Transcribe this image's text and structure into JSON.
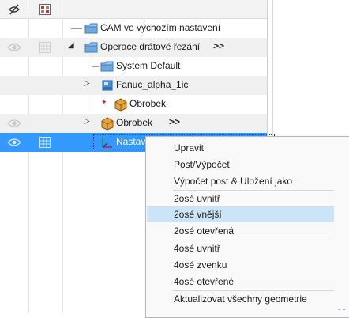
{
  "tree": {
    "rows": [
      {
        "label": "CAM ve výchozím nastavení",
        "arrows": ""
      },
      {
        "label": "Operace drátové řezání",
        "arrows": ">>"
      },
      {
        "label": "System Default",
        "arrows": ""
      },
      {
        "label": "Fanuc_alpha_1ic",
        "arrows": ""
      },
      {
        "label": "Obrobek",
        "arrows": ""
      },
      {
        "label": "Obrobek",
        "arrows": ">>"
      },
      {
        "label": "Nastav",
        "arrows": ""
      }
    ]
  },
  "context_menu": {
    "items": [
      "Upravit",
      "Post/Výpočet",
      "Výpočet post & Uložení jako",
      "2osé uvnitř",
      "2osé vnější",
      "2osé otevřená",
      "4osé uvnitř",
      "4osé zvenku",
      "4osé otevřené",
      "Aktualizovat všechny geometrie"
    ],
    "highlighted": "2osé vnější"
  },
  "colors": {
    "selection": "#3399ff",
    "menu_highlight": "#cce4f7",
    "folder": "#6fa8dc",
    "box": "#e6a23c"
  }
}
